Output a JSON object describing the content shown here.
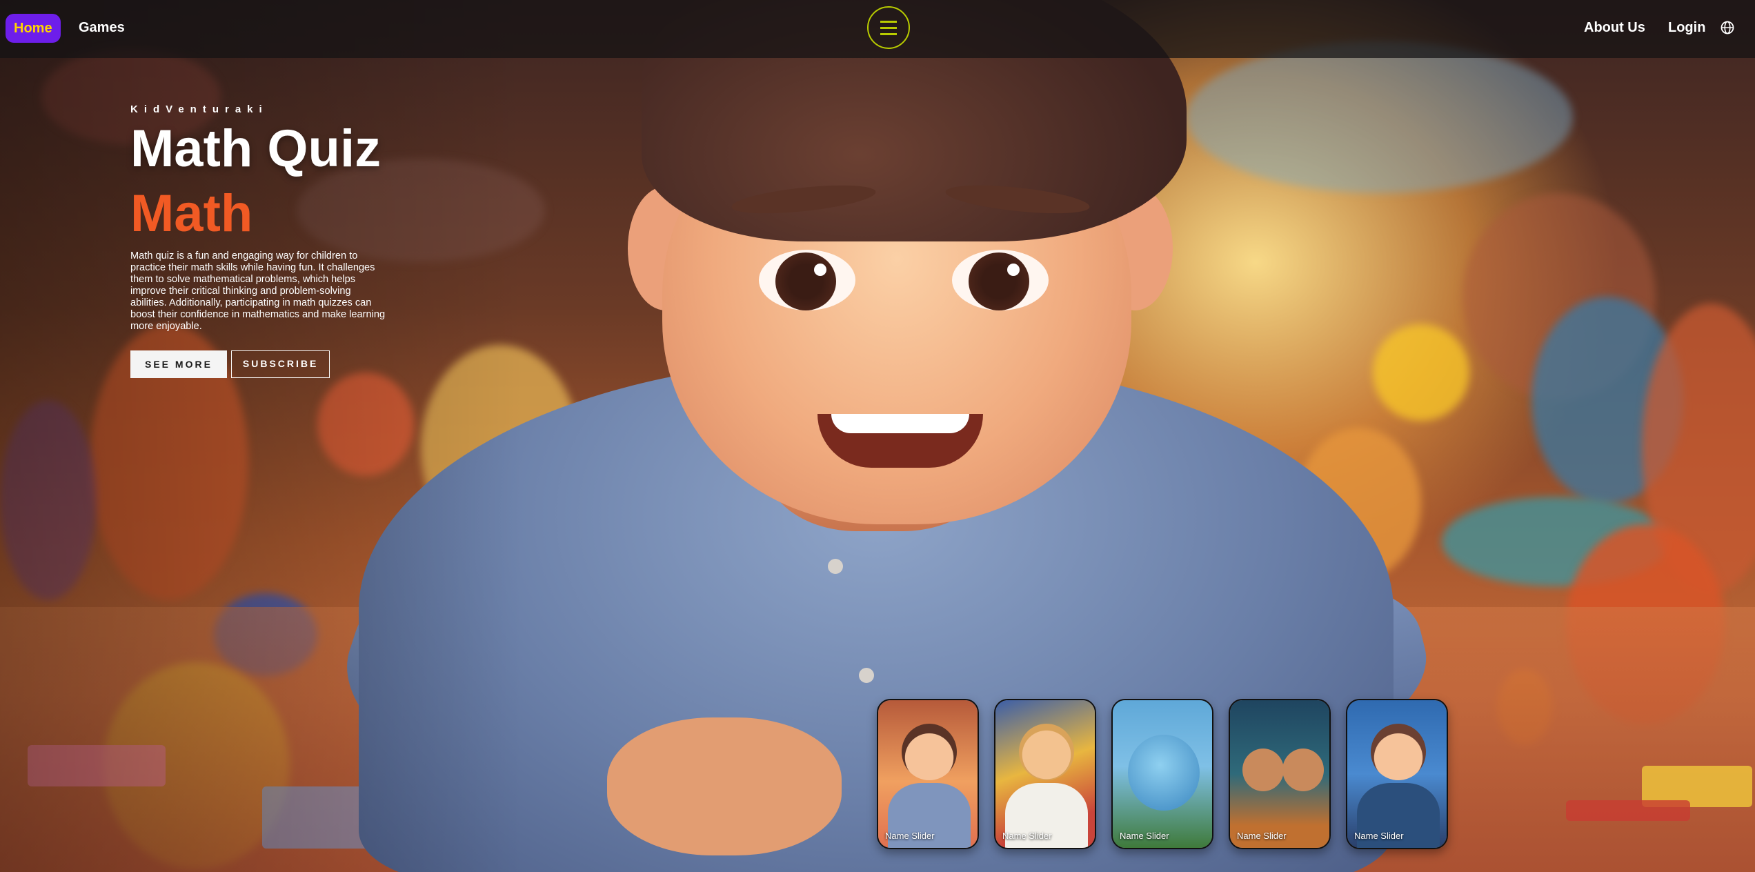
{
  "nav": {
    "home": "Home",
    "games": "Games",
    "about": "About Us",
    "login": "Login",
    "menu_icon": "hamburger-menu-icon",
    "language_icon": "globe-icon",
    "accent_color": "#6d1eea",
    "home_text_color": "#ffd400",
    "menu_ring_color": "#b9cc00"
  },
  "hero": {
    "eyebrow": "KidVenturaki",
    "title": "Math Quiz",
    "topic": "Math",
    "topic_color": "#f15a24",
    "description": "Math quiz is a fun and engaging way for children to practice their math skills while having fun. It challenges them to solve mathematical problems, which helps improve their critical thinking and problem-solving abilities. Additionally, participating in math quizzes can boost their confidence in mathematics and make learning more enjoyable.",
    "see_more": "SEE MORE",
    "subscribe": "SUBSCRIBE"
  },
  "slider": {
    "items": [
      {
        "label": "Name Slider"
      },
      {
        "label": "Name Slider"
      },
      {
        "label": "Name Slider"
      },
      {
        "label": "Name Slider"
      },
      {
        "label": "Name Slider"
      }
    ]
  }
}
